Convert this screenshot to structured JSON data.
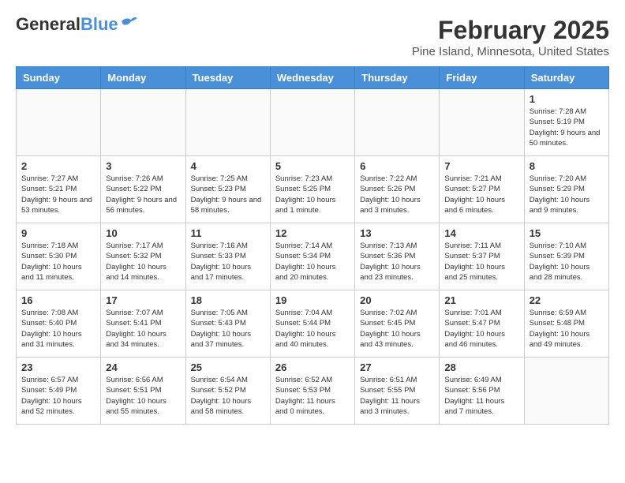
{
  "header": {
    "logo_general": "General",
    "logo_blue": "Blue",
    "title": "February 2025",
    "subtitle": "Pine Island, Minnesota, United States"
  },
  "days_of_week": [
    "Sunday",
    "Monday",
    "Tuesday",
    "Wednesday",
    "Thursday",
    "Friday",
    "Saturday"
  ],
  "weeks": [
    [
      {
        "day": "",
        "info": ""
      },
      {
        "day": "",
        "info": ""
      },
      {
        "day": "",
        "info": ""
      },
      {
        "day": "",
        "info": ""
      },
      {
        "day": "",
        "info": ""
      },
      {
        "day": "",
        "info": ""
      },
      {
        "day": "1",
        "info": "Sunrise: 7:28 AM\nSunset: 5:19 PM\nDaylight: 9 hours and 50 minutes."
      }
    ],
    [
      {
        "day": "2",
        "info": "Sunrise: 7:27 AM\nSunset: 5:21 PM\nDaylight: 9 hours and 53 minutes."
      },
      {
        "day": "3",
        "info": "Sunrise: 7:26 AM\nSunset: 5:22 PM\nDaylight: 9 hours and 56 minutes."
      },
      {
        "day": "4",
        "info": "Sunrise: 7:25 AM\nSunset: 5:23 PM\nDaylight: 9 hours and 58 minutes."
      },
      {
        "day": "5",
        "info": "Sunrise: 7:23 AM\nSunset: 5:25 PM\nDaylight: 10 hours and 1 minute."
      },
      {
        "day": "6",
        "info": "Sunrise: 7:22 AM\nSunset: 5:26 PM\nDaylight: 10 hours and 3 minutes."
      },
      {
        "day": "7",
        "info": "Sunrise: 7:21 AM\nSunset: 5:27 PM\nDaylight: 10 hours and 6 minutes."
      },
      {
        "day": "8",
        "info": "Sunrise: 7:20 AM\nSunset: 5:29 PM\nDaylight: 10 hours and 9 minutes."
      }
    ],
    [
      {
        "day": "9",
        "info": "Sunrise: 7:18 AM\nSunset: 5:30 PM\nDaylight: 10 hours and 11 minutes."
      },
      {
        "day": "10",
        "info": "Sunrise: 7:17 AM\nSunset: 5:32 PM\nDaylight: 10 hours and 14 minutes."
      },
      {
        "day": "11",
        "info": "Sunrise: 7:16 AM\nSunset: 5:33 PM\nDaylight: 10 hours and 17 minutes."
      },
      {
        "day": "12",
        "info": "Sunrise: 7:14 AM\nSunset: 5:34 PM\nDaylight: 10 hours and 20 minutes."
      },
      {
        "day": "13",
        "info": "Sunrise: 7:13 AM\nSunset: 5:36 PM\nDaylight: 10 hours and 23 minutes."
      },
      {
        "day": "14",
        "info": "Sunrise: 7:11 AM\nSunset: 5:37 PM\nDaylight: 10 hours and 25 minutes."
      },
      {
        "day": "15",
        "info": "Sunrise: 7:10 AM\nSunset: 5:39 PM\nDaylight: 10 hours and 28 minutes."
      }
    ],
    [
      {
        "day": "16",
        "info": "Sunrise: 7:08 AM\nSunset: 5:40 PM\nDaylight: 10 hours and 31 minutes."
      },
      {
        "day": "17",
        "info": "Sunrise: 7:07 AM\nSunset: 5:41 PM\nDaylight: 10 hours and 34 minutes."
      },
      {
        "day": "18",
        "info": "Sunrise: 7:05 AM\nSunset: 5:43 PM\nDaylight: 10 hours and 37 minutes."
      },
      {
        "day": "19",
        "info": "Sunrise: 7:04 AM\nSunset: 5:44 PM\nDaylight: 10 hours and 40 minutes."
      },
      {
        "day": "20",
        "info": "Sunrise: 7:02 AM\nSunset: 5:45 PM\nDaylight: 10 hours and 43 minutes."
      },
      {
        "day": "21",
        "info": "Sunrise: 7:01 AM\nSunset: 5:47 PM\nDaylight: 10 hours and 46 minutes."
      },
      {
        "day": "22",
        "info": "Sunrise: 6:59 AM\nSunset: 5:48 PM\nDaylight: 10 hours and 49 minutes."
      }
    ],
    [
      {
        "day": "23",
        "info": "Sunrise: 6:57 AM\nSunset: 5:49 PM\nDaylight: 10 hours and 52 minutes."
      },
      {
        "day": "24",
        "info": "Sunrise: 6:56 AM\nSunset: 5:51 PM\nDaylight: 10 hours and 55 minutes."
      },
      {
        "day": "25",
        "info": "Sunrise: 6:54 AM\nSunset: 5:52 PM\nDaylight: 10 hours and 58 minutes."
      },
      {
        "day": "26",
        "info": "Sunrise: 6:52 AM\nSunset: 5:53 PM\nDaylight: 11 hours and 0 minutes."
      },
      {
        "day": "27",
        "info": "Sunrise: 6:51 AM\nSunset: 5:55 PM\nDaylight: 11 hours and 3 minutes."
      },
      {
        "day": "28",
        "info": "Sunrise: 6:49 AM\nSunset: 5:56 PM\nDaylight: 11 hours and 7 minutes."
      },
      {
        "day": "",
        "info": ""
      }
    ]
  ]
}
